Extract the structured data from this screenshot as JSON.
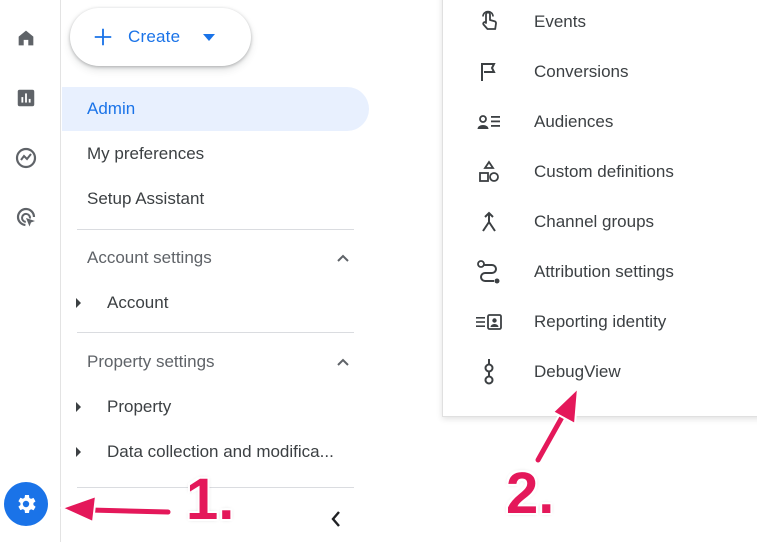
{
  "colors": {
    "accent": "#1a73e8",
    "selected_bg": "#e8f0fe",
    "annotation": "#e4185a"
  },
  "rail": {
    "icons": [
      "home-icon",
      "reports-icon",
      "explore-icon",
      "advertising-icon"
    ],
    "bottom_icon": "gear-icon"
  },
  "nav": {
    "create_label": "Create",
    "items": [
      "Admin",
      "My preferences",
      "Setup Assistant"
    ],
    "sections": [
      {
        "title": "Account settings",
        "children": [
          "Account"
        ]
      },
      {
        "title": "Property settings",
        "children": [
          "Property",
          "Data collection and modifica..."
        ]
      }
    ]
  },
  "menu": {
    "items": [
      {
        "label": "Events",
        "icon": "touch-icon"
      },
      {
        "label": "Conversions",
        "icon": "flag-icon"
      },
      {
        "label": "Audiences",
        "icon": "audiences-icon"
      },
      {
        "label": "Custom definitions",
        "icon": "shapes-icon"
      },
      {
        "label": "Channel groups",
        "icon": "merge-icon"
      },
      {
        "label": "Attribution settings",
        "icon": "route-icon"
      },
      {
        "label": "Reporting identity",
        "icon": "identity-icon"
      },
      {
        "label": "DebugView",
        "icon": "debug-icon"
      }
    ]
  },
  "annotations": {
    "step1": "1.",
    "step2": "2."
  }
}
